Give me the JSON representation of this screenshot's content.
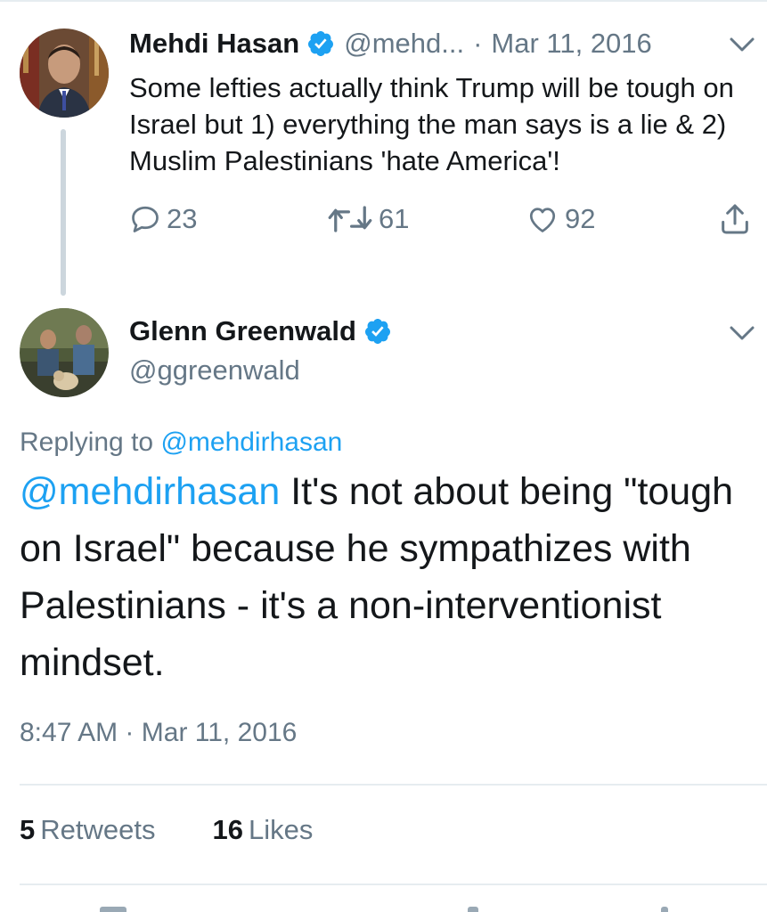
{
  "parent_tweet": {
    "author_name": "Mehdi Hasan",
    "handle": "@mehd...",
    "separator": "·",
    "date": "Mar 11, 2016",
    "text": "Some lefties actually think Trump will be tough on Israel but 1) everything the man says is a lie & 2) Muslim Palestinians 'hate America'!",
    "reply_count": "23",
    "retweet_count": "61",
    "like_count": "92",
    "icons": [
      "reply-icon",
      "retweet-icon",
      "like-icon",
      "share-icon",
      "verified-icon",
      "chevron-down-icon"
    ]
  },
  "main_tweet": {
    "author_name": "Glenn Greenwald",
    "handle": "@ggreenwald",
    "replying_prefix": "Replying to",
    "replying_to": "@mehdirhasan",
    "mention": "@mehdirhasan",
    "text": " It's not about being \"tough on Israel\" because he sympathizes with Palestinians - it's a non-interventionist mindset.",
    "time": "8:47 AM",
    "separator": "·",
    "date": "Mar 11, 2016",
    "retweets_count": "5",
    "retweets_label": "Retweets",
    "likes_count": "16",
    "likes_label": "Likes"
  },
  "colors": {
    "link": "#1da1f2",
    "secondary_text": "#657786",
    "primary_text": "#14171a",
    "divider": "#e6ecf0",
    "verified": "#1da1f2"
  }
}
